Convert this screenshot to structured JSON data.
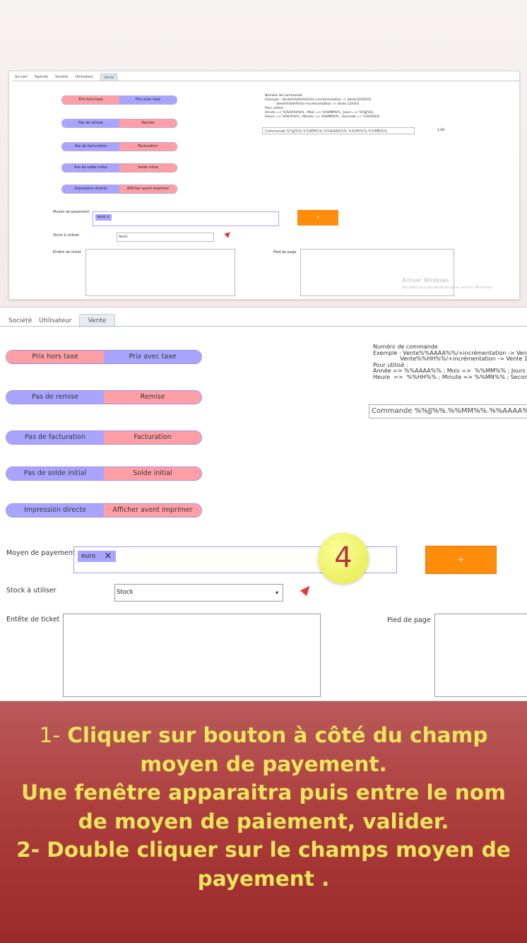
{
  "mini": {
    "tabs": [
      "Accueil",
      "Agenda",
      "Société",
      "Utilisateur",
      "Vente"
    ],
    "info": "Numéro de commande\nExemple : Vente%%AAAA%%/+incrémentation -> Vente/2020/10\n           Vente%%HH%%/+incrémentation -> Vente 12h/10\nPour utilisé :\nAnnée => %%AAAA%% ; Mois => %%MM%% ; Jours => %%JJ%% ;\nHeure => %%HH%% ; Minute => %%MN%% ; Seconde => %%SS%%",
    "command_value": "Commande %%JJ%%.%%MM%%.%%AAAA%% %%HH%%:%%MN%%",
    "small_number": "1,00",
    "watermark_title": "Activer Windows",
    "watermark_sub": "Accédez aux paramètres pour activer Windows."
  },
  "tabs": {
    "societe": "Société",
    "utilisateur": "Utilisateur",
    "vente": "Vente"
  },
  "toggles": [
    {
      "left": "Prix hors taxe",
      "right": "Prix avec taxe",
      "active": "right"
    },
    {
      "left": "Pas de remise",
      "right": "Remise",
      "active": "left"
    },
    {
      "left": "Pas de facturation",
      "right": "Facturation",
      "active": "left"
    },
    {
      "left": "Pas de solde initial",
      "right": "Solde initial",
      "active": "left"
    },
    {
      "left": "Impression directe",
      "right": "Afficher avent imprimer",
      "active": "left"
    }
  ],
  "order_info": "Numéro de commande\nExemple : Vente%%AAAA%%/+incrémentation -> Vente/\n               Vente%%HH%%/+incrémentation -> Vente 12h\nPour utilisé :\nAnnée => %%AAAA%% ; Mois =>  %%MM%% ; Jours  =\nHeure  =>  %%HH%% ; Minute => %%MN%% ; Second",
  "command_value": "Commande %%JJ%%.%%MM%%.%%AAAA%",
  "payment": {
    "label": "Moyen de payement",
    "chip": "euro",
    "chip_remove": "×",
    "add_button": "+"
  },
  "stock": {
    "label": "Stock à utiliser",
    "value": "Stock"
  },
  "ticket": {
    "header_label": "Entête de ticket",
    "footer_label": "Pied de page"
  },
  "step_badge": "4",
  "instructions": {
    "num1": "1-",
    "line1": "Cliquer sur bouton  à côté du champ moyen de payement.",
    "line2": "Une fenêtre apparaitra  puis entre le nom de moyen de paiement, valider.",
    "line3": "2- Double cliquer sur le champs moyen de payement ."
  },
  "colors": {
    "pink": "#ff9fa5",
    "lavender": "#a9a5ff",
    "orange": "#ff8c0a",
    "banner": "#a83838",
    "banner_text": "#ede55c"
  }
}
